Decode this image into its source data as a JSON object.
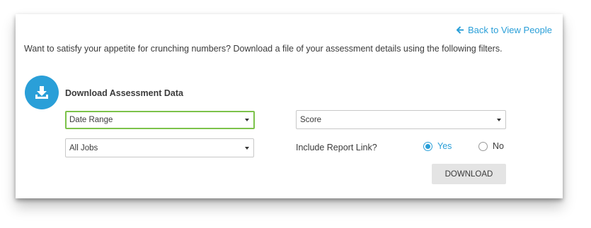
{
  "back_link": {
    "label": "Back to View People",
    "icon": "arrow-left-icon"
  },
  "intro_text": "Want to satisfy your appetite for crunching numbers? Download a file of your assessment details using the following filters.",
  "section": {
    "title": "Download Assessment Data",
    "icon": "download-tray-icon"
  },
  "filters": {
    "date_range": "Date Range",
    "score": "Score",
    "jobs": "All Jobs"
  },
  "report_link": {
    "label": "Include Report Link?",
    "options": [
      "Yes",
      "No"
    ],
    "selected": "Yes"
  },
  "download_button": "DOWNLOAD",
  "colors": {
    "accent": "#2a9fd8",
    "focus_border": "#7cc24a",
    "button_bg": "#e4e4e4"
  }
}
